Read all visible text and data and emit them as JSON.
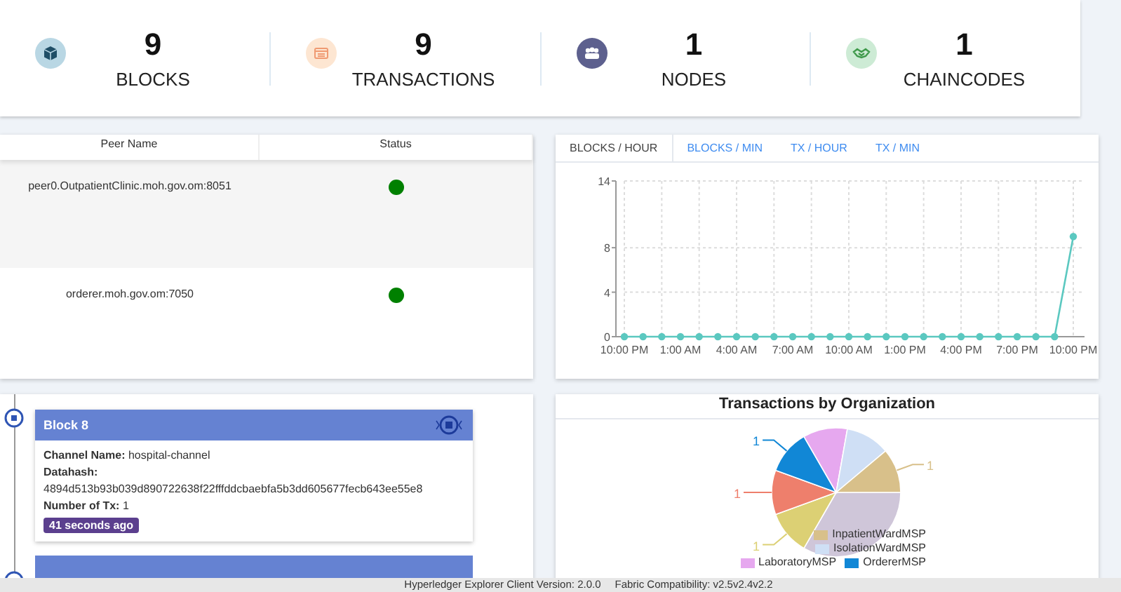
{
  "stats": [
    {
      "kind": "blocks",
      "value": "9",
      "label": "BLOCKS"
    },
    {
      "kind": "transactions",
      "value": "9",
      "label": "TRANSACTIONS"
    },
    {
      "kind": "nodes",
      "value": "1",
      "label": "NODES"
    },
    {
      "kind": "chaincodes",
      "value": "1",
      "label": "CHAINCODES"
    }
  ],
  "peers": {
    "columns": [
      "Peer Name",
      "Status"
    ],
    "rows": [
      {
        "name": "peer0.OutpatientClinic.moh.gov.om:8051",
        "color": "#008000"
      },
      {
        "name": "orderer.moh.gov.om:7050",
        "color": "#008000"
      }
    ]
  },
  "chart_tabs": [
    {
      "label": "BLOCKS / HOUR",
      "selected": true
    },
    {
      "label": "BLOCKS / MIN",
      "selected": false
    },
    {
      "label": "TX / HOUR",
      "selected": false
    },
    {
      "label": "TX / MIN",
      "selected": false
    }
  ],
  "blocks_chart": {
    "chart_data": {
      "type": "line",
      "categories": [
        "10:00 PM",
        null,
        null,
        "1:00 AM",
        null,
        null,
        "4:00 AM",
        null,
        null,
        "7:00 AM",
        null,
        null,
        "10:00 AM",
        null,
        null,
        "1:00 PM",
        null,
        null,
        "4:00 PM",
        null,
        null,
        "7:00 PM",
        null,
        null,
        "10:00 PM"
      ],
      "series": [
        {
          "color": "#5bc8c0",
          "marker": "circle",
          "values": [
            0,
            0,
            0,
            0,
            0,
            0,
            0,
            0,
            0,
            0,
            0,
            0,
            0,
            0,
            0,
            0,
            0,
            0,
            0,
            0,
            0,
            0,
            0,
            0,
            9
          ]
        }
      ],
      "ylim": [
        0,
        14
      ],
      "yticks": [
        0,
        4,
        8,
        14
      ],
      "grid": true
    }
  },
  "block_card": {
    "title": "Block 8",
    "channel_label": "Channel Name:",
    "channel": "hospital-channel",
    "datahash_label": "Datahash:",
    "datahash": "4894d513b93b039d890722638f22fffddcbaebfa5b3dd605677fecb643ee55e8",
    "tx_label": "Number of Tx:",
    "tx": "1",
    "age": "41 seconds ago"
  },
  "org_chart": {
    "title": "Transactions by Organization",
    "slice_labels": [
      "1",
      "1",
      "1",
      "1"
    ],
    "legend": [
      {
        "label": "InpatientWardMSP",
        "color": "#d8c08a"
      },
      {
        "label": "IsolationWardMSP",
        "color": "#cfdff5"
      },
      {
        "label": "LaboratoryMSP",
        "color": "#e6a8ef"
      },
      {
        "label": "OrdererMSP",
        "color": "#1187d6"
      }
    ]
  },
  "footer": {
    "version": "Hyperledger Explorer Client Version: 2.0.0",
    "compat": "Fabric Compatibility: v2.5v2.4v2.2"
  }
}
